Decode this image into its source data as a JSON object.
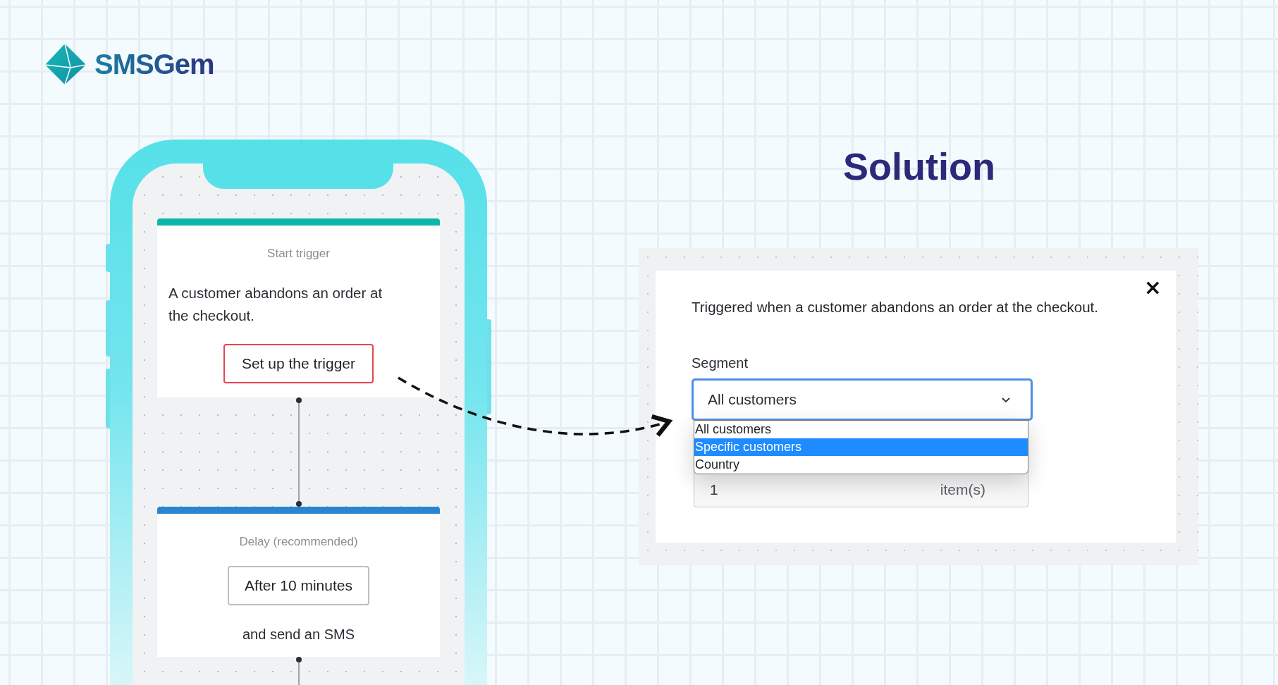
{
  "brand": {
    "name": "SMSGem"
  },
  "flow": {
    "cards": [
      {
        "kind": "trigger",
        "title": "Start trigger",
        "description": "A customer abandons an order at the checkout.",
        "button": "Set up the trigger",
        "highlighted": true
      },
      {
        "kind": "delay",
        "title": "Delay (recommended)",
        "button": "After 10 minutes",
        "footer": "and send an SMS",
        "highlighted": false
      }
    ]
  },
  "heading": "Solution",
  "dialog": {
    "description": "Triggered when a customer abandons an order at the checkout.",
    "close": "×",
    "segment_label": "Segment",
    "select": {
      "value": "All customers",
      "expanded": true,
      "options": [
        {
          "label": "All customers",
          "highlighted": false
        },
        {
          "label": "Specific customers",
          "highlighted": true
        },
        {
          "label": "Country",
          "highlighted": false
        }
      ]
    },
    "quantity": {
      "value": "1",
      "unit": "item(s)"
    }
  }
}
